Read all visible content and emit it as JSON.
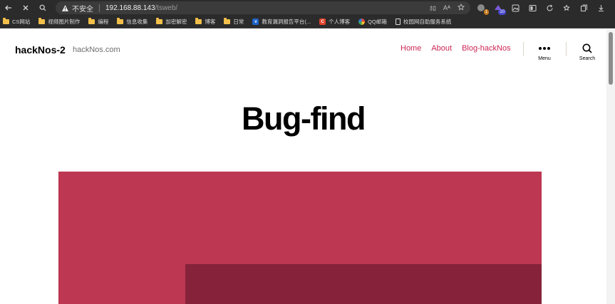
{
  "browser": {
    "security_label": "不安全",
    "url_host": "192.168.88.143",
    "url_path": "/tsweb/",
    "reader_label": "ﾎﾛ",
    "translate_label": "Aᴬ",
    "ext_badge_1": "1",
    "ext_badge_2": "10"
  },
  "bookmarks": [
    {
      "label": "CS网站",
      "icon": "folder"
    },
    {
      "label": "视频图片制作",
      "icon": "folder"
    },
    {
      "label": "编程",
      "icon": "folder"
    },
    {
      "label": "信息收集",
      "icon": "folder"
    },
    {
      "label": "加密解密",
      "icon": "folder"
    },
    {
      "label": "博客",
      "icon": "folder"
    },
    {
      "label": "日常",
      "icon": "folder"
    },
    {
      "label": "教育漏洞报告平台(...",
      "icon": "edu-icon"
    },
    {
      "label": "个人博客",
      "icon": "csdn-icon"
    },
    {
      "label": "QQ邮箱",
      "icon": "qqmail-icon"
    },
    {
      "label": "校园网自助服务系统",
      "icon": "page-icon"
    }
  ],
  "site": {
    "title": "hackNos-2",
    "description": "hackNos.com",
    "nav": [
      "Home",
      "About",
      "Blog-hackNos"
    ],
    "menu_label": "Menu",
    "search_label": "Search",
    "accent_color": "#cd2653"
  },
  "post": {
    "title": "Bug-find"
  },
  "colors": {
    "featured_main": "#bd3752",
    "featured_dark": "#86233a"
  }
}
